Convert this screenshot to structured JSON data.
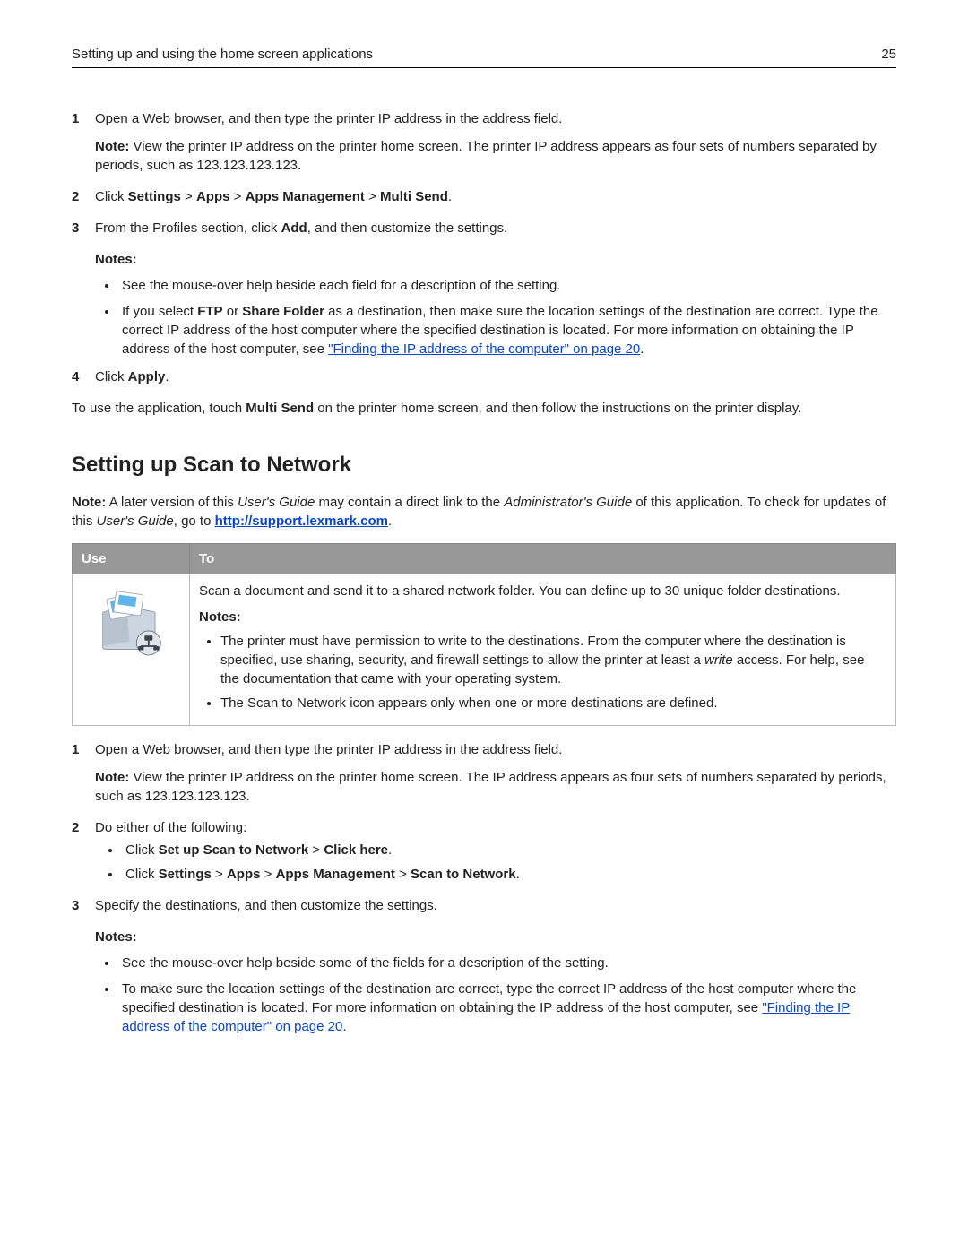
{
  "header": {
    "title": "Setting up and using the home screen applications",
    "page_number": "25"
  },
  "section1": {
    "step1": {
      "num": "1",
      "text": "Open a Web browser, and then type the printer IP address in the address field.",
      "note_label": "Note:",
      "note_text": " View the printer IP address on the printer home screen. The printer IP address appears as four sets of numbers separated by periods, such as 123.123.123.123."
    },
    "step2": {
      "num": "2",
      "prefix": " Click ",
      "b1": "Settings",
      "sep1": " > ",
      "b2": "Apps",
      "sep2": " > ",
      "b3": "Apps Management",
      "sep3": " > ",
      "b4": "Multi Send",
      "suffix": "."
    },
    "step3": {
      "num": "3",
      "pre": "From the Profiles section, click ",
      "bold": "Add",
      "post": ", and then customize the settings."
    },
    "notes_label": "Notes:",
    "bullet1": "See the mouse‑over help beside each field for a description of the setting.",
    "bullet2": {
      "pre": "If you select ",
      "b1": "FTP",
      "mid1": " or ",
      "b2": "Share Folder",
      "mid2": " as a destination, then make sure the location settings of the destination are correct. Type the correct IP address of the host computer where the specified destination is located. For more information on obtaining the IP address of the host computer, see ",
      "link": "\"Finding the IP address of the computer\" on page 20",
      "post": "."
    },
    "step4": {
      "num": "4",
      "pre": "Click ",
      "bold": "Apply",
      "post": "."
    },
    "closing": {
      "pre": "To use the application, touch ",
      "bold": "Multi Send",
      "post": " on the printer home screen, and then follow the instructions on the printer display."
    }
  },
  "section2": {
    "heading": "Setting up Scan to Network",
    "note_para": {
      "label": "Note:",
      "p1": " A later version of this ",
      "i1": "User's Guide",
      "p2": " may contain a direct link to the ",
      "i2": "Administrator's Guide",
      "p3": " of this application. To check for updates of this ",
      "i3": "User's Guide",
      "p4": ", go to ",
      "link": "http://support.lexmark.com",
      "p5": "."
    },
    "table": {
      "th_use": "Use",
      "th_to": "To",
      "desc": "Scan a document and send it to a shared network folder. You can define up to 30 unique folder destinations.",
      "notes_label": "Notes:",
      "tb1": {
        "pre": "The printer must have permission to write to the destinations. From the computer where the destination is specified, use sharing, security, and firewall settings to allow the printer at least a ",
        "i": "write",
        "post": " access. For help, see the documentation that came with your operating system."
      },
      "tb2": "The Scan to Network icon appears only when one or more destinations are defined."
    },
    "step1": {
      "num": "1",
      "text": "Open a Web browser, and then type the printer IP address in the address field.",
      "note_label": "Note:",
      "note_text": " View the printer IP address on the printer home screen. The IP address appears as four sets of numbers separated by periods, such as 123.123.123.123."
    },
    "step2": {
      "num": "2",
      "text": "Do either of the following:",
      "opt1": {
        "pre": "Click ",
        "b1": "Set up Scan to Network",
        "sep": " > ",
        "b2": "Click here",
        "post": "."
      },
      "opt2": {
        "pre": "Click ",
        "b1": "Settings",
        "s1": " > ",
        "b2": "Apps",
        "s2": " > ",
        "b3": "Apps Management",
        "s3": " > ",
        "b4": "Scan to Network",
        "post": "."
      }
    },
    "step3": {
      "num": "3",
      "text": "Specify the destinations, and then customize the settings."
    },
    "notes_label2": "Notes:",
    "bullet1_b": "See the mouse‑over help beside some of the fields for a description of the setting.",
    "bullet2_b": {
      "pre": "To make sure the location settings of the destination are correct, type the correct IP address of the host computer where the specified destination is located. For more information on obtaining the IP address of the host computer, see ",
      "link": "\"Finding the IP address of the computer\" on page 20",
      "post": "."
    }
  }
}
